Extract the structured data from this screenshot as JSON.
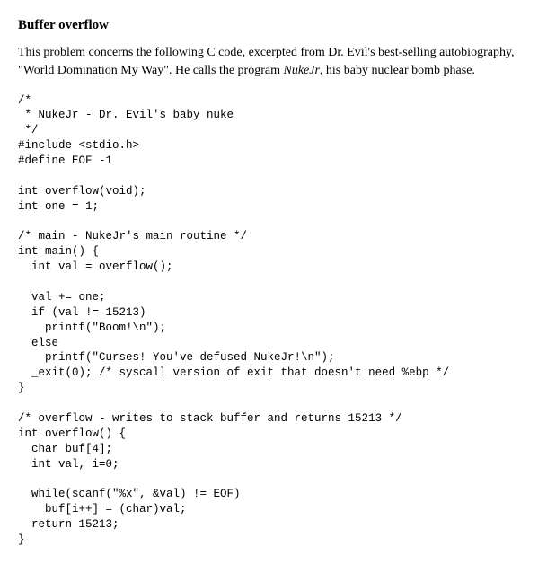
{
  "title": "Buffer overflow",
  "intro_pre": "This problem concerns the following C code, excerpted from Dr. Evil's best-selling autobiography, \"World Domination My Way\". He calls the program ",
  "intro_em": "NukeJr",
  "intro_post": ", his baby nuclear bomb phase.",
  "code": "/*\n * NukeJr - Dr. Evil's baby nuke\n */\n#include <stdio.h>\n#define EOF -1\n\nint overflow(void);\nint one = 1;\n\n/* main - NukeJr's main routine */\nint main() {\n  int val = overflow();\n\n  val += one;\n  if (val != 15213)\n    printf(\"Boom!\\n\");\n  else\n    printf(\"Curses! You've defused NukeJr!\\n\");\n  _exit(0); /* syscall version of exit that doesn't need %ebp */\n}\n\n/* overflow - writes to stack buffer and returns 15213 */\nint overflow() {\n  char buf[4];\n  int val, i=0;\n\n  while(scanf(\"%x\", &val) != EOF)\n    buf[i++] = (char)val;\n  return 15213;\n}"
}
